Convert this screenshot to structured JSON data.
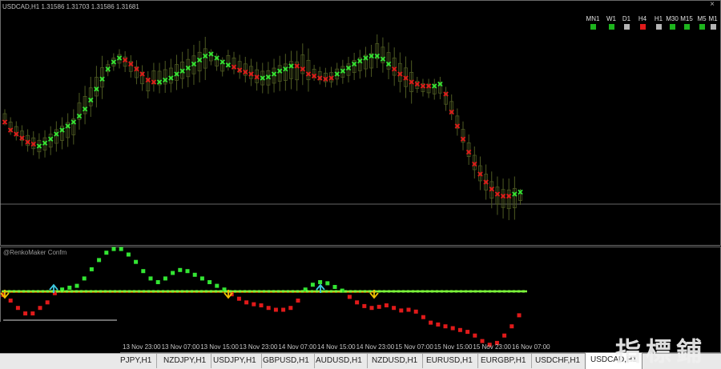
{
  "header": {
    "symbol": "USDCAD,H1",
    "quote": "1.31586 1.31703 1.31586 1.31681",
    "close_glyph": "×"
  },
  "subwindow": {
    "title": "@RenkoMaker Confm"
  },
  "timeframes": [
    {
      "label": "MN1",
      "color": "#1db51d"
    },
    {
      "label": "W1",
      "color": "#1db51d"
    },
    {
      "label": "D1",
      "color": "#b4b4b4"
    },
    {
      "label": "H4",
      "color": "#e01a1a"
    },
    {
      "label": "H1",
      "color": "#b4b4b4"
    },
    {
      "label": "M30",
      "color": "#1db51d"
    },
    {
      "label": "M15",
      "color": "#1db51d"
    },
    {
      "label": "M5",
      "color": "#1db51d"
    },
    {
      "label": "M1",
      "color": "#b4b4b4"
    }
  ],
  "time_axis": [
    "13 Nov 23:00",
    "13 Nov 07:00",
    "13 Nov 15:00",
    "13 Nov 23:00",
    "14 Nov 07:00",
    "14 Nov 15:00",
    "14 Nov 23:00",
    "15 Nov 07:00",
    "15 Nov 15:00",
    "15 Nov 23:00",
    "16 Nov 07:00"
  ],
  "tabs": [
    {
      "label": "PJPY,H1",
      "active": false
    },
    {
      "label": "NZDJPY,H1",
      "active": false
    },
    {
      "label": "USDJPY,H1",
      "active": false
    },
    {
      "label": "GBPUSD,H1",
      "active": false
    },
    {
      "label": "AUDUSD,H1",
      "active": false
    },
    {
      "label": "NZDUSD,H1",
      "active": false
    },
    {
      "label": "EURUSD,H1",
      "active": false
    },
    {
      "label": "EURGBP,H1",
      "active": false
    },
    {
      "label": "USDCHF,H1",
      "active": false
    },
    {
      "label": "USDCAD,H1",
      "active": true
    }
  ],
  "watermark": {
    "text": "指標鋪",
    "url": "www.zhibiaopu.com"
  },
  "colors": {
    "up": "#33e533",
    "down": "#e01a1a",
    "zero_line_green": "#7cff3a",
    "zero_line_orange": "#ff8a00",
    "arrow_up": "#3ec8e0",
    "arrow_down": "#f0c000",
    "candle": "#4e5a22"
  },
  "chart_data": {
    "type": "line",
    "main_markers": {
      "x_index": [
        0,
        1,
        2,
        3,
        4,
        5,
        6,
        7,
        8,
        9,
        10,
        11,
        12,
        13,
        14,
        15,
        16,
        17,
        18,
        19,
        20,
        21,
        22,
        23,
        24,
        25,
        26,
        27,
        28,
        29,
        30,
        31,
        32,
        33,
        34,
        35,
        36,
        37,
        38,
        39,
        40,
        41,
        42,
        43,
        44,
        45,
        46,
        47,
        48,
        49,
        50,
        51,
        52,
        53,
        54,
        55,
        56,
        57,
        58,
        59,
        60,
        61,
        62,
        63,
        64,
        65,
        66,
        67,
        68,
        69,
        70,
        71,
        72,
        73,
        74,
        75,
        76,
        77,
        78,
        79,
        80,
        81,
        82,
        83,
        84,
        85,
        86,
        87,
        88,
        89,
        90
      ],
      "trend": [
        "d",
        "d",
        "d",
        "d",
        "d",
        "d",
        "u",
        "u",
        "u",
        "u",
        "u",
        "u",
        "u",
        "u",
        "u",
        "u",
        "u",
        "u",
        "u",
        "u",
        "u",
        "d",
        "d",
        "d",
        "d",
        "d",
        "d",
        "u",
        "u",
        "u",
        "u",
        "u",
        "u",
        "u",
        "u",
        "u",
        "u",
        "u",
        "u",
        "u",
        "d",
        "d",
        "d",
        "d",
        "d",
        "u",
        "u",
        "u",
        "u",
        "u",
        "u",
        "d",
        "d",
        "d",
        "d",
        "d",
        "d",
        "d",
        "u",
        "u",
        "u",
        "u",
        "u",
        "u",
        "u",
        "u",
        "u",
        "u",
        "d",
        "d",
        "d",
        "d",
        "d",
        "d",
        "d",
        "u",
        "u",
        "d",
        "d",
        "d",
        "d",
        "d",
        "d",
        "d",
        "d",
        "d",
        "d",
        "d",
        "d",
        "u",
        "u"
      ],
      "level": [
        0.78,
        0.86,
        0.9,
        0.94,
        0.98,
        1.0,
        1.02,
        0.99,
        0.95,
        0.9,
        0.86,
        0.82,
        0.78,
        0.72,
        0.65,
        0.56,
        0.45,
        0.35,
        0.25,
        0.18,
        0.14,
        0.16,
        0.2,
        0.25,
        0.3,
        0.36,
        0.38,
        0.38,
        0.36,
        0.34,
        0.3,
        0.27,
        0.24,
        0.2,
        0.16,
        0.12,
        0.1,
        0.14,
        0.18,
        0.21,
        0.23,
        0.26,
        0.28,
        0.3,
        0.33,
        0.34,
        0.33,
        0.3,
        0.27,
        0.25,
        0.22,
        0.22,
        0.25,
        0.3,
        0.32,
        0.34,
        0.35,
        0.34,
        0.3,
        0.27,
        0.24,
        0.2,
        0.17,
        0.14,
        0.12,
        0.12,
        0.15,
        0.2,
        0.25,
        0.3,
        0.34,
        0.38,
        0.4,
        0.42,
        0.42,
        0.42,
        0.4,
        0.5,
        0.68,
        0.82,
        0.95,
        1.08,
        1.2,
        1.3,
        1.38,
        1.45,
        1.5,
        1.52,
        1.52,
        1.5,
        1.48
      ]
    },
    "sub_histogram": {
      "values": [
        -0.1,
        -0.25,
        -0.45,
        -0.6,
        -0.6,
        -0.45,
        -0.3,
        -0.05,
        0.05,
        0.1,
        0.15,
        0.35,
        0.6,
        0.85,
        1.05,
        1.15,
        1.15,
        1.0,
        0.8,
        0.55,
        0.35,
        0.25,
        0.35,
        0.5,
        0.58,
        0.55,
        0.45,
        0.35,
        0.25,
        0.15,
        0.05,
        -0.08,
        -0.2,
        -0.3,
        -0.35,
        -0.38,
        -0.45,
        -0.5,
        -0.5,
        -0.45,
        -0.25,
        0.05,
        0.18,
        0.25,
        0.22,
        0.12,
        0.02,
        -0.15,
        -0.3,
        -0.4,
        -0.45,
        -0.42,
        -0.38,
        -0.45,
        -0.52,
        -0.5,
        -0.55,
        -0.7,
        -0.85,
        -0.9,
        -0.95,
        -1.0,
        -1.05,
        -1.1,
        -1.2,
        -1.35,
        -1.45,
        -1.4,
        -1.2,
        -0.95,
        -0.65
      ]
    }
  }
}
